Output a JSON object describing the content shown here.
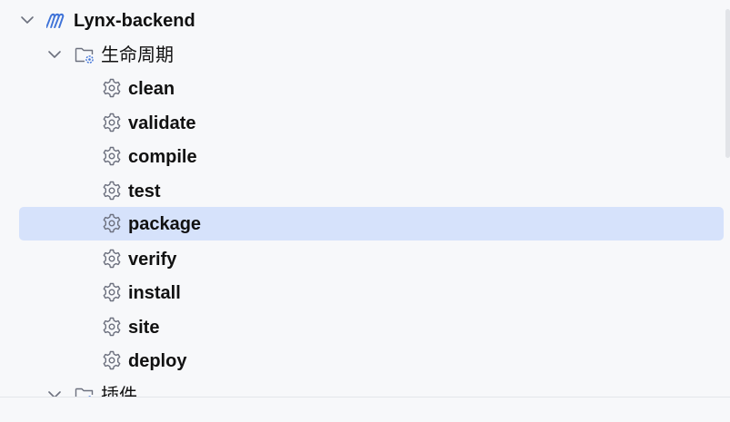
{
  "tree": {
    "project": {
      "name": "Lynx-backend",
      "icon": "maven-icon",
      "accent": "#3f73d8",
      "expanded": true
    },
    "lifecycle": {
      "label": "生命周期",
      "icon": "folder-gear-icon",
      "expanded": true,
      "phases": [
        {
          "label": "clean",
          "icon": "gear-icon"
        },
        {
          "label": "validate",
          "icon": "gear-icon"
        },
        {
          "label": "compile",
          "icon": "gear-icon"
        },
        {
          "label": "test",
          "icon": "gear-icon"
        },
        {
          "label": "package",
          "icon": "gear-icon",
          "selected": true
        },
        {
          "label": "verify",
          "icon": "gear-icon"
        },
        {
          "label": "install",
          "icon": "gear-icon"
        },
        {
          "label": "site",
          "icon": "gear-icon"
        },
        {
          "label": "deploy",
          "icon": "gear-icon"
        }
      ]
    },
    "plugins": {
      "label": "插件",
      "icon": "folder-gear-icon",
      "expanded": true
    }
  },
  "colors": {
    "background": "#f7f8fa",
    "selection": "#d6e2fb",
    "icon_gray": "#6c707e",
    "icon_blue": "#3f73d8"
  }
}
